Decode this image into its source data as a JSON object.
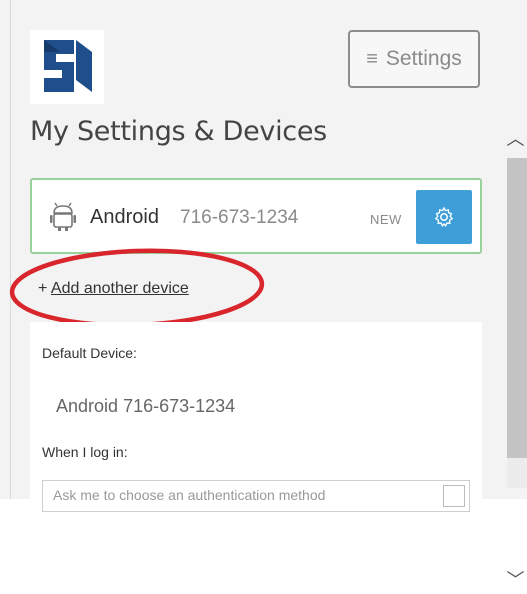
{
  "header": {
    "logo_icon": "duo-logo-icon",
    "settings_label": "Settings",
    "settings_icon": "hamburger-icon"
  },
  "page": {
    "title": "My Settings & Devices"
  },
  "device": {
    "icon": "android-icon",
    "name": "Android",
    "number": "716-673-1234",
    "badge": "NEW",
    "gear_icon": "gear-icon",
    "accent_color": "#3e9fd8",
    "border_color": "#9ad19a"
  },
  "add_device": {
    "prefix": "+",
    "label": "Add another device"
  },
  "settings_panel": {
    "default_label": "Default Device:",
    "default_name": "Android",
    "default_number": "716-673-1234",
    "login_label": "When I log in:",
    "login_value": "Ask me to choose an authentication method"
  },
  "annotation": {
    "highlight_color": "#d9262c"
  }
}
